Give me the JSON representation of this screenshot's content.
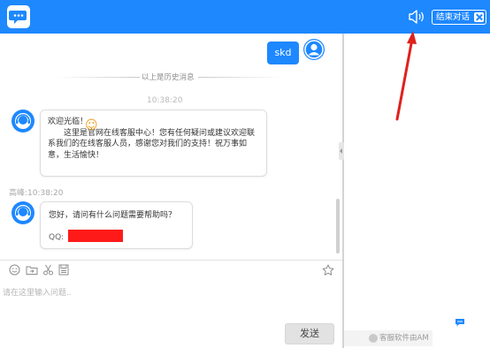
{
  "header": {
    "end_chat_label": "结束对话",
    "accent_color": "#1e88ff"
  },
  "chat": {
    "user_message": "skd",
    "history_notice": "以上是历史消息",
    "center_time": "10:38:20",
    "welcome_title": "欢迎光临！",
    "welcome_body": "这里是官网在线客服中心！您有任何疑问或建议欢迎联系我们的在线客服人员，感谢您对我们的支持！祝万事如意，生活愉快！",
    "agent_time": "高峰:10:38:20",
    "agent_question": "您好，请问有什么问题需要帮助吗？",
    "qq_label": "QQ:",
    "input_placeholder": "请在这里输入问题..",
    "send_label": "发送"
  },
  "side": {
    "powered_text": "客服软件由AM"
  },
  "icons": [
    "logo-icon",
    "speaker-icon",
    "close-icon",
    "user-avatar-icon",
    "agent-avatar-icon",
    "emoji-icon",
    "folder-icon",
    "scissors-icon",
    "save-icon",
    "star-icon",
    "chat-bubble-icon"
  ]
}
